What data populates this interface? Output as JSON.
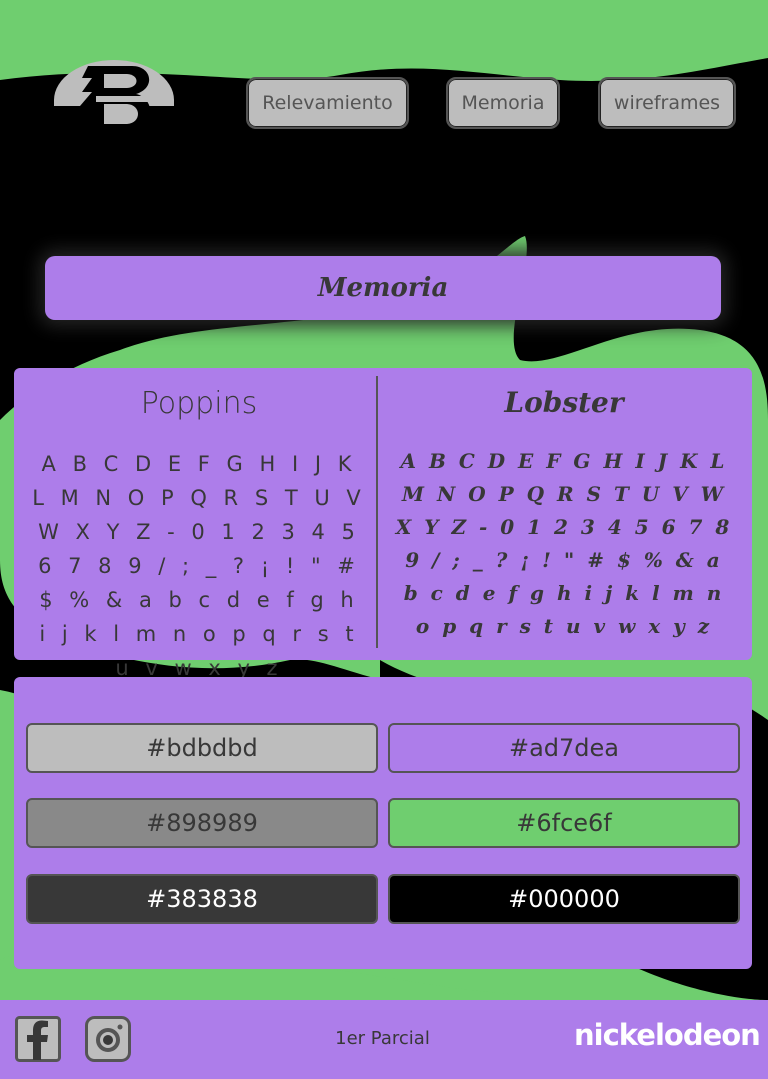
{
  "colors": {
    "accent_green": "#6fce6f",
    "accent_purple": "#ad7dea",
    "light_gray": "#bdbdbd",
    "dark_text": "#383838"
  },
  "header": {
    "logo": "ghost-logo-icon",
    "nav": [
      {
        "label": "Relevamiento"
      },
      {
        "label": "Memoria"
      },
      {
        "label": "wireframes"
      }
    ]
  },
  "page_title": "Memoria",
  "fonts": {
    "left": {
      "name": "Poppins",
      "sample": "A B C D E F G H I J K L M N O P Q R S T U V W X Y Z - 0 1 2 3 4 5 6 7 8 9 / ; _ ? ¡ ! \" # $ % & a b c d e f g h i j k l m n o p q r s t u v w x y z"
    },
    "right": {
      "name": "Lobster",
      "sample": "A B C D E F G H I J K L M N O P Q R S T U V W X Y Z - 0 1 2 3 4 5 6 7 8 9 / ; _ ? ¡ ! \" # $ % & a b c d e f g h i j k l m n o p q r s t u v w x y z"
    }
  },
  "palette": [
    {
      "hex": "#bdbdbd",
      "label": "#bdbdbd",
      "text": "#383838"
    },
    {
      "hex": "#ad7dea",
      "label": "#ad7dea",
      "text": "#383838"
    },
    {
      "hex": "#898989",
      "label": "#898989",
      "text": "#383838"
    },
    {
      "hex": "#6fce6f",
      "label": "#6fce6f",
      "text": "#383838"
    },
    {
      "hex": "#383838",
      "label": "#383838",
      "text": "#ffffff"
    },
    {
      "hex": "#000000",
      "label": "#000000",
      "text": "#ffffff"
    }
  ],
  "footer": {
    "icons": [
      "facebook-icon",
      "instagram-icon"
    ],
    "text": "1er Parcial",
    "brand": "nickelodeon"
  }
}
